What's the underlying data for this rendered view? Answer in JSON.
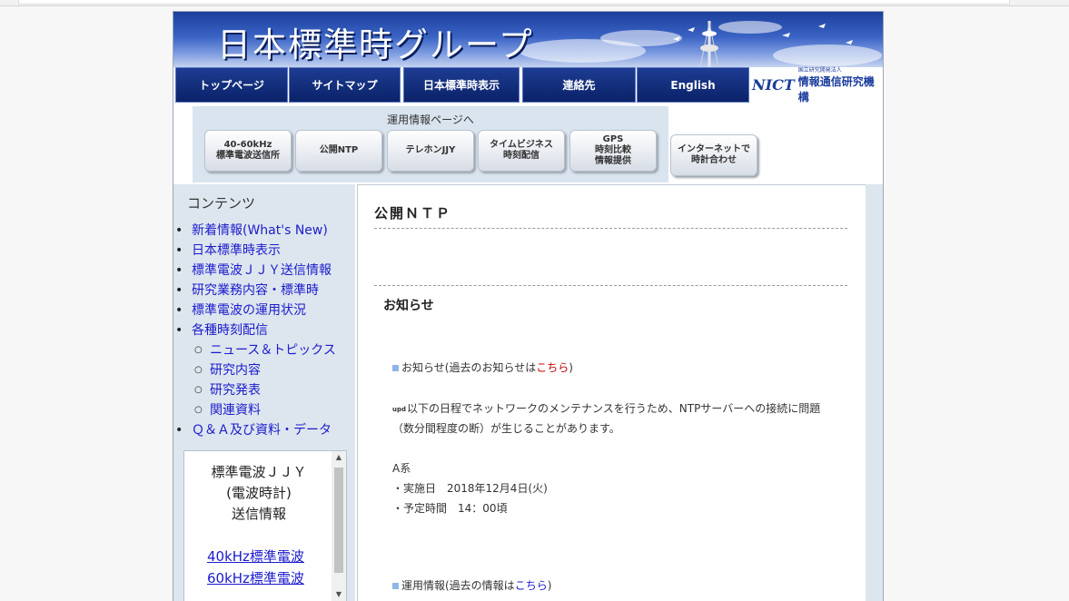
{
  "banner": {
    "title": "日本標準時グループ"
  },
  "nav": {
    "items": [
      "トップページ",
      "サイトマップ",
      "日本標準時表示",
      "連絡先",
      "English"
    ],
    "logo": {
      "mark": "NICT",
      "small": "国立研究開発法人",
      "big": "情報通信研究機構"
    }
  },
  "ops": {
    "label": "運用情報ページへ",
    "buttons": [
      "40-60kHz\n標準電波送信所",
      "公開NTP",
      "テレホンJJY",
      "タイムビジネス\n時刻配信",
      "GPS\n時刻比較\n情報提供"
    ],
    "internet": "インターネットで\n時計合わせ"
  },
  "sidebar": {
    "heading": "コンテンツ",
    "items": [
      {
        "label": "新着情報(What's New)",
        "level": 1
      },
      {
        "label": "日本標準時表示",
        "level": 1
      },
      {
        "label": "標準電波ＪＪＹ送信情報",
        "level": 1
      },
      {
        "label": "研究業務内容・標準時",
        "level": 1
      },
      {
        "label": "標準電波の運用状況",
        "level": 1
      },
      {
        "label": "各種時刻配信",
        "level": 1
      },
      {
        "label": "ニュース＆トピックス",
        "level": 2
      },
      {
        "label": "研究内容",
        "level": 2
      },
      {
        "label": "研究発表",
        "level": 2
      },
      {
        "label": "関連資料",
        "level": 2
      },
      {
        "label": "Ｑ＆Ａ及び資料・データ",
        "level": 1
      }
    ],
    "jjy": {
      "title": "標準電波ＪＪＹ\n(電波時計)\n送信情報",
      "link40": "40kHz標準電波",
      "link60": "60kHz標準電波"
    }
  },
  "content": {
    "title": "公開ＮＴＰ",
    "notice_heading": "お知らせ",
    "notice_line_prefix": "お知らせ(過去のお知らせは",
    "notice_link": "こちら",
    "notice_line_suffix": ")",
    "maintenance_icon": "upd",
    "maintenance_text1": "以下の日程でネットワークのメンテナンスを行うため、NTPサーバーへの接続に問題",
    "maintenance_text2": "（数分間程度の断）が生じることがあります。",
    "system": "A系",
    "date": "・実施日　2018年12月4日(火)",
    "time": "・予定時間　14：00頃",
    "ops_line_prefix": "運用情報(過去の情報は",
    "ops_link": "こちら",
    "ops_line_suffix": ")"
  }
}
